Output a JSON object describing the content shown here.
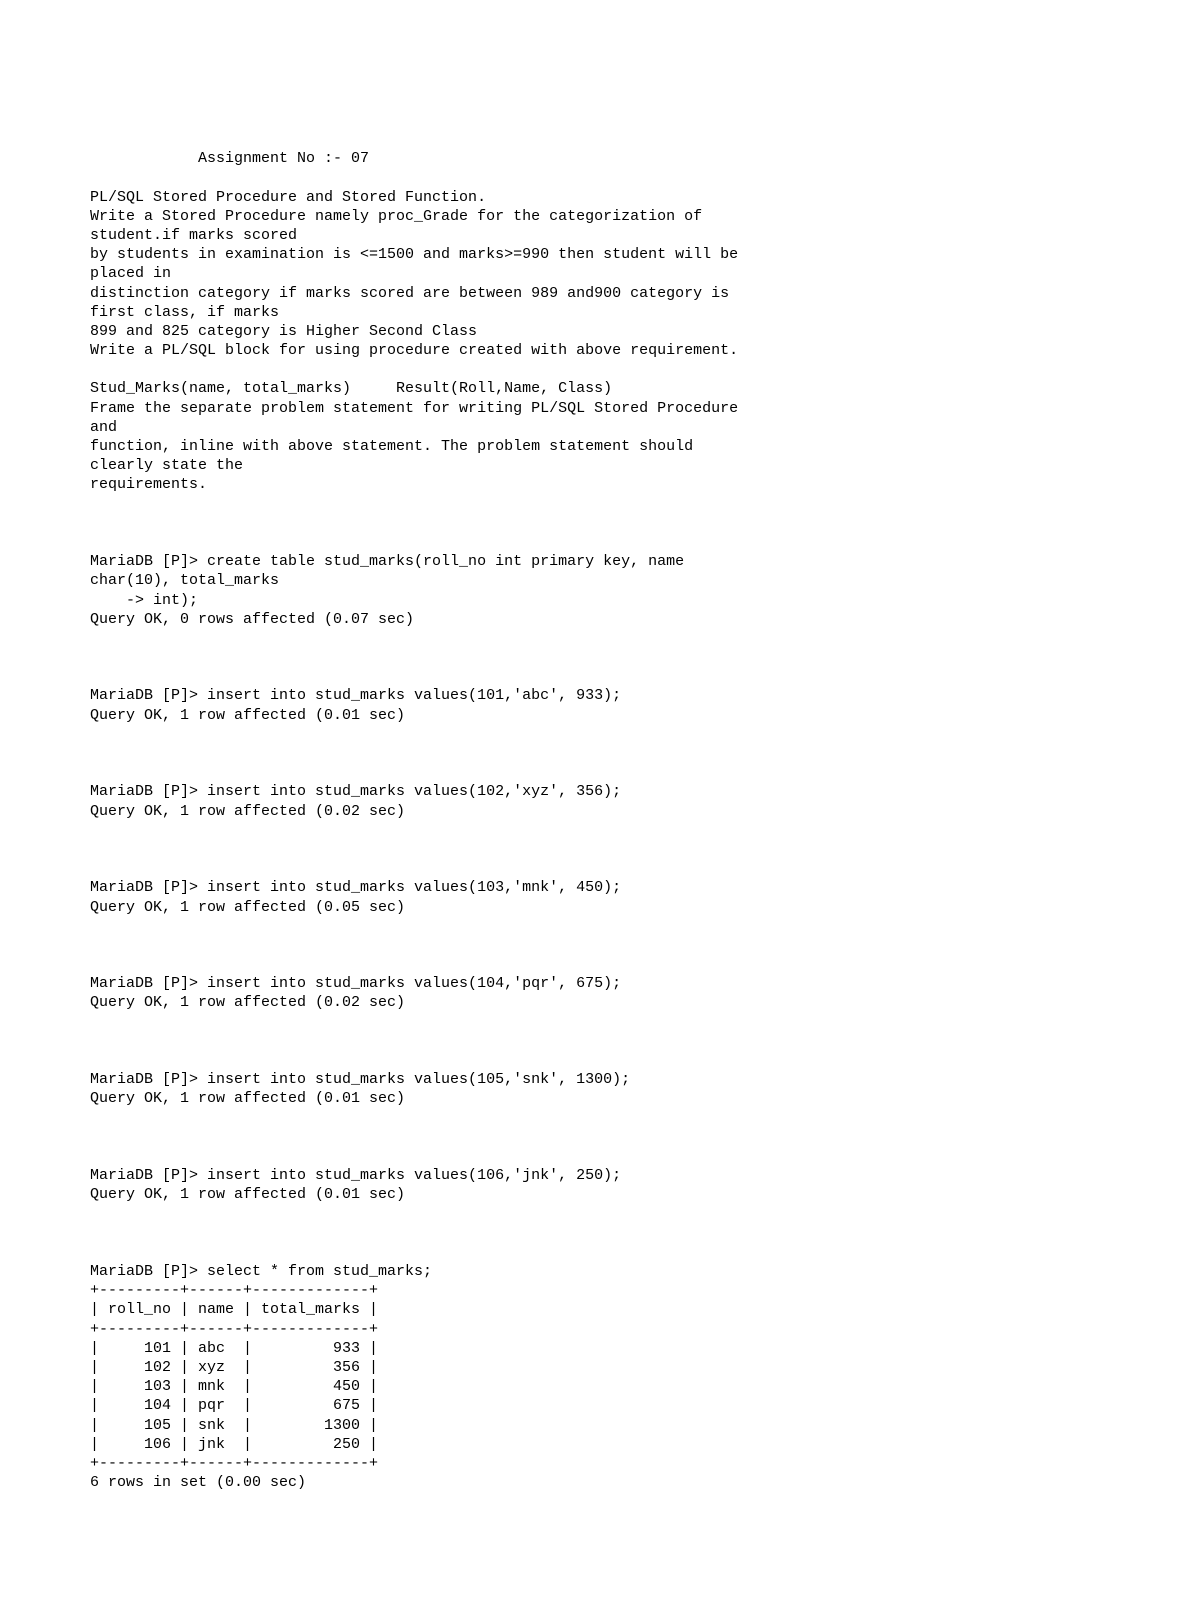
{
  "doc": {
    "title": "            Assignment No :- 07",
    "intro": "PL/SQL Stored Procedure and Stored Function.\nWrite a Stored Procedure namely proc_Grade for the categorization of\nstudent.if marks scored\nby students in examination is <=1500 and marks>=990 then student will be\nplaced in\ndistinction category if marks scored are between 989 and900 category is\nfirst class, if marks\n899 and 825 category is Higher Second Class\nWrite a PL/SQL block for using procedure created with above requirement.\n\nStud_Marks(name, total_marks)     Result(Roll,Name, Class)\nFrame the separate problem statement for writing PL/SQL Stored Procedure\nand\nfunction, inline with above statement. The problem statement should\nclearly state the\nrequirements.",
    "create": "MariaDB [P]> create table stud_marks(roll_no int primary key, name\nchar(10), total_marks\n    -> int);\nQuery OK, 0 rows affected (0.07 sec)",
    "ins1": "MariaDB [P]> insert into stud_marks values(101,'abc', 933);\nQuery OK, 1 row affected (0.01 sec)",
    "ins2": "MariaDB [P]> insert into stud_marks values(102,'xyz', 356);\nQuery OK, 1 row affected (0.02 sec)",
    "ins3": "MariaDB [P]> insert into stud_marks values(103,'mnk', 450);\nQuery OK, 1 row affected (0.05 sec)",
    "ins4": "MariaDB [P]> insert into stud_marks values(104,'pqr', 675);\nQuery OK, 1 row affected (0.02 sec)",
    "ins5": "MariaDB [P]> insert into stud_marks values(105,'snk', 1300);\nQuery OK, 1 row affected (0.01 sec)",
    "ins6": "MariaDB [P]> insert into stud_marks values(106,'jnk', 250);\nQuery OK, 1 row affected (0.01 sec)",
    "select": "MariaDB [P]> select * from stud_marks;\n+---------+------+-------------+\n| roll_no | name | total_marks |\n+---------+------+-------------+\n|     101 | abc  |         933 |\n|     102 | xyz  |         356 |\n|     103 | mnk  |         450 |\n|     104 | pqr  |         675 |\n|     105 | snk  |        1300 |\n|     106 | jnk  |         250 |\n+---------+------+-------------+\n6 rows in set (0.00 sec)"
  }
}
